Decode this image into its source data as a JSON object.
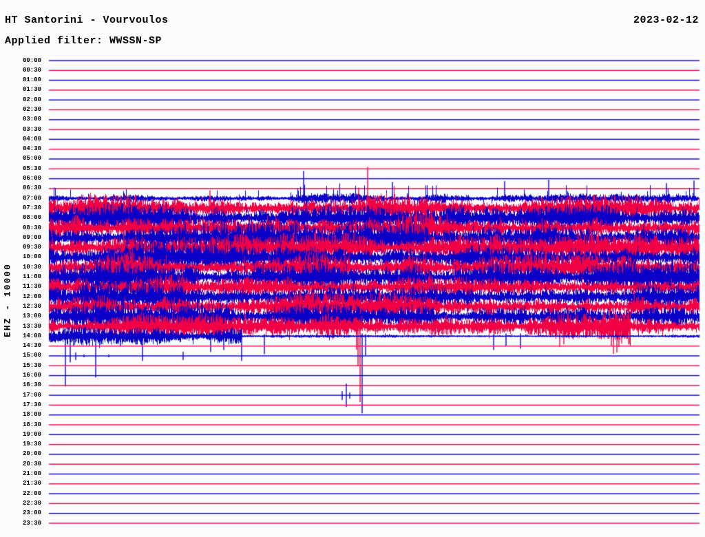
{
  "header": {
    "station_title": "HT Santorini - Vourvoulos",
    "date": "2023-02-12",
    "filter_label": "Applied filter: WWSSN-SP"
  },
  "axis": {
    "scale_label": "EHZ - 10000"
  },
  "colors": {
    "background": "#FCFCFC",
    "text": "#000000",
    "trace_blue": "#0A00C8",
    "trace_red": "#F10043"
  },
  "chart_data": {
    "type": "helicorder",
    "station": "HT Santorini - Vourvoulos",
    "channel_scale": "EHZ - 10000",
    "date": "2023-02-12",
    "filter": "WWSSN-SP",
    "minutes_per_line": 30,
    "legend": "rows alternate blue/red per half hour; heavy continuous seismic noise from ~07:00 to ~14:00 UTC",
    "rows": [
      {
        "t": "00:00",
        "c": "blue",
        "seg": [],
        "spk": []
      },
      {
        "t": "00:30",
        "c": "red",
        "seg": [],
        "spk": []
      },
      {
        "t": "01:00",
        "c": "blue",
        "seg": [],
        "spk": []
      },
      {
        "t": "01:30",
        "c": "red",
        "seg": [],
        "spk": []
      },
      {
        "t": "02:00",
        "c": "blue",
        "seg": [],
        "spk": []
      },
      {
        "t": "02:30",
        "c": "red",
        "seg": [],
        "spk": []
      },
      {
        "t": "03:00",
        "c": "blue",
        "seg": [],
        "spk": []
      },
      {
        "t": "03:30",
        "c": "red",
        "seg": [],
        "spk": []
      },
      {
        "t": "04:00",
        "c": "blue",
        "seg": [],
        "spk": []
      },
      {
        "t": "04:30",
        "c": "red",
        "seg": [],
        "spk": []
      },
      {
        "t": "05:00",
        "c": "blue",
        "seg": [],
        "spk": []
      },
      {
        "t": "05:30",
        "c": "red",
        "seg": [],
        "spk": []
      },
      {
        "t": "06:00",
        "c": "blue",
        "seg": [],
        "spk": []
      },
      {
        "t": "06:30",
        "c": "red",
        "seg": [],
        "spk": []
      },
      {
        "t": "07:00",
        "c": "blue",
        "seg": [
          [
            71,
            420,
            3.4,
            0.05,
            14
          ],
          [
            420,
            650,
            3.8,
            0.1,
            20
          ],
          [
            650,
            1016,
            3.4,
            0.06,
            15
          ]
        ],
        "spk": [
          [
            441,
            40,
            6
          ],
          [
            570,
            24,
            5
          ],
          [
            733,
            25,
            4
          ],
          [
            797,
            27,
            4
          ],
          [
            968,
            22,
            4
          ],
          [
            1008,
            26,
            4
          ]
        ]
      },
      {
        "t": "07:30",
        "c": "red",
        "seg": [
          [
            71,
            420,
            10,
            0.06,
            12
          ],
          [
            420,
            650,
            11,
            0.1,
            16
          ],
          [
            650,
            1016,
            10,
            0.06,
            12
          ]
        ],
        "spk": [
          [
            305,
            26,
            6
          ],
          [
            521,
            30,
            6
          ],
          [
            534,
            60,
            8
          ]
        ]
      },
      {
        "t": "08:00",
        "c": "blue",
        "seg": [
          [
            71,
            1016,
            10.5,
            0.06,
            10
          ]
        ],
        "spk": []
      },
      {
        "t": "08:30",
        "c": "red",
        "seg": [
          [
            71,
            1016,
            11,
            0.06,
            10
          ]
        ],
        "spk": []
      },
      {
        "t": "09:00",
        "c": "blue",
        "seg": [
          [
            71,
            1016,
            11,
            0.06,
            11
          ]
        ],
        "spk": []
      },
      {
        "t": "09:30",
        "c": "red",
        "seg": [
          [
            71,
            1016,
            10.5,
            0.06,
            10
          ]
        ],
        "spk": []
      },
      {
        "t": "10:00",
        "c": "blue",
        "seg": [
          [
            71,
            1016,
            11.5,
            0.06,
            11
          ]
        ],
        "spk": []
      },
      {
        "t": "10:30",
        "c": "red",
        "seg": [
          [
            71,
            1016,
            10.5,
            0.06,
            10
          ]
        ],
        "spk": []
      },
      {
        "t": "11:00",
        "c": "blue",
        "seg": [
          [
            71,
            1016,
            11.5,
            0.06,
            11
          ]
        ],
        "spk": []
      },
      {
        "t": "11:30",
        "c": "red",
        "seg": [
          [
            71,
            1016,
            10.5,
            0.06,
            10
          ]
        ],
        "spk": []
      },
      {
        "t": "12:00",
        "c": "blue",
        "seg": [
          [
            71,
            1016,
            11,
            0.06,
            11
          ]
        ],
        "spk": []
      },
      {
        "t": "12:30",
        "c": "red",
        "seg": [
          [
            71,
            1016,
            10.5,
            0.06,
            10
          ]
        ],
        "spk": []
      },
      {
        "t": "13:00",
        "c": "blue",
        "seg": [
          [
            71,
            1016,
            10,
            0.06,
            10
          ]
        ],
        "spk": []
      },
      {
        "t": "13:30",
        "c": "red",
        "seg": [
          [
            71,
            868,
            9,
            0.05,
            9
          ],
          [
            868,
            916,
            14,
            0.22,
            18
          ],
          [
            916,
            1016,
            8.5,
            0.05,
            9
          ]
        ],
        "spk": [
          [
            518,
            5,
            34
          ],
          [
            520,
            6,
            58
          ],
          [
            523,
            6,
            110
          ],
          [
            813,
            4,
            30
          ],
          [
            819,
            4,
            26
          ],
          [
            883,
            6,
            18
          ],
          [
            888,
            6,
            28
          ],
          [
            891,
            7,
            40
          ],
          [
            896,
            6,
            38
          ],
          [
            899,
            6,
            30
          ],
          [
            903,
            6,
            25
          ],
          [
            908,
            5,
            15
          ]
        ]
      },
      {
        "t": "14:00",
        "c": "blue",
        "seg": [
          [
            71,
            351,
            6.8,
            0.05,
            7
          ],
          [
            351,
            1016,
            1.4,
            0.02,
            4
          ]
        ],
        "spk": [
          [
            95,
            4,
            73
          ],
          [
            102,
            5,
            38
          ],
          [
            139,
            4,
            60
          ],
          [
            175,
            3,
            15
          ],
          [
            207,
            4,
            36
          ],
          [
            306,
            5,
            23
          ],
          [
            325,
            4,
            20
          ],
          [
            351,
            5,
            36
          ],
          [
            384,
            3,
            26
          ],
          [
            526,
            4,
            112
          ],
          [
            531,
            3,
            28
          ],
          [
            717,
            3,
            20
          ],
          [
            735,
            4,
            14
          ],
          [
            756,
            4,
            18
          ]
        ]
      },
      {
        "t": "14:30",
        "c": "red",
        "seg": [],
        "spk": []
      },
      {
        "t": "15:00",
        "c": "blue",
        "seg": [],
        "spk": [
          [
            110,
            5,
            6
          ],
          [
            122,
            2,
            2
          ],
          [
            158,
            2,
            2
          ],
          [
            266,
            6,
            6
          ]
        ]
      },
      {
        "t": "15:30",
        "c": "red",
        "seg": [],
        "spk": []
      },
      {
        "t": "16:00",
        "c": "blue",
        "seg": [],
        "spk": []
      },
      {
        "t": "16:30",
        "c": "red",
        "seg": [],
        "spk": []
      },
      {
        "t": "17:00",
        "c": "blue",
        "seg": [],
        "spk": [
          [
            497,
            6,
            7
          ],
          [
            503,
            17,
            17
          ],
          [
            508,
            4,
            5
          ]
        ]
      },
      {
        "t": "17:30",
        "c": "red",
        "seg": [],
        "spk": []
      },
      {
        "t": "18:00",
        "c": "blue",
        "seg": [],
        "spk": []
      },
      {
        "t": "18:30",
        "c": "red",
        "seg": [],
        "spk": []
      },
      {
        "t": "19:00",
        "c": "blue",
        "seg": [],
        "spk": []
      },
      {
        "t": "19:30",
        "c": "red",
        "seg": [],
        "spk": []
      },
      {
        "t": "20:00",
        "c": "blue",
        "seg": [],
        "spk": []
      },
      {
        "t": "20:30",
        "c": "red",
        "seg": [],
        "spk": []
      },
      {
        "t": "21:00",
        "c": "blue",
        "seg": [],
        "spk": []
      },
      {
        "t": "21:30",
        "c": "red",
        "seg": [],
        "spk": []
      },
      {
        "t": "22:00",
        "c": "blue",
        "seg": [],
        "spk": []
      },
      {
        "t": "22:30",
        "c": "red",
        "seg": [],
        "spk": []
      },
      {
        "t": "23:00",
        "c": "blue",
        "seg": [],
        "spk": []
      },
      {
        "t": "23:30",
        "c": "red",
        "seg": [],
        "spk": []
      }
    ]
  }
}
